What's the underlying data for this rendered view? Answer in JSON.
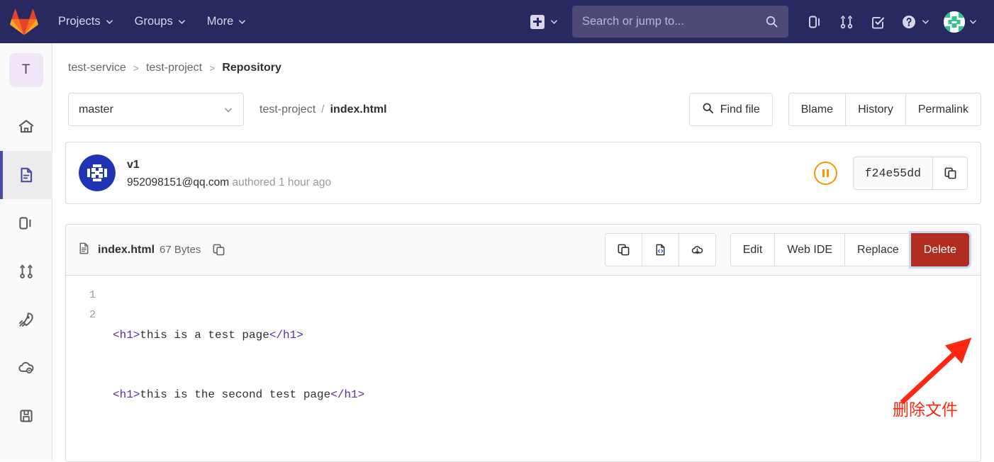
{
  "navbar": {
    "logo_icon": "gitlab-logo-icon",
    "links": [
      {
        "label": "Projects",
        "icon": "chevron-down-icon"
      },
      {
        "label": "Groups",
        "icon": "chevron-down-icon"
      },
      {
        "label": "More",
        "icon": "chevron-down-icon"
      }
    ],
    "create_new": {
      "icon": "plus-square-icon",
      "caret": "chevron-down-icon"
    },
    "search": {
      "placeholder": "Search or jump to...",
      "value": "",
      "icon": "search-icon"
    },
    "icons": [
      {
        "name": "issues-icon"
      },
      {
        "name": "merge-requests-icon"
      },
      {
        "name": "todos-icon"
      },
      {
        "name": "help-icon"
      }
    ],
    "avatar": {
      "name": "user-avatar",
      "color": "#31c48d"
    },
    "background": "#292961"
  },
  "sidebar": {
    "project_avatar": {
      "label": "T",
      "background": "#f0e6f7"
    },
    "items": [
      {
        "name": "sidebar-item-project-overview",
        "icon": "home-icon",
        "active": false
      },
      {
        "name": "sidebar-item-repository",
        "icon": "document-icon",
        "active": true
      },
      {
        "name": "sidebar-item-issues",
        "icon": "issues-icon",
        "active": false
      },
      {
        "name": "sidebar-item-merge-requests",
        "icon": "merge-request-icon",
        "active": false
      },
      {
        "name": "sidebar-item-cicd",
        "icon": "rocket-icon",
        "active": false
      },
      {
        "name": "sidebar-item-operations",
        "icon": "cloud-gear-icon",
        "active": false
      },
      {
        "name": "sidebar-item-packages",
        "icon": "package-icon",
        "active": false
      }
    ],
    "active_color": "#4b4ba3"
  },
  "breadcrumb": {
    "group": "test-service",
    "project": "test-project",
    "section": "Repository",
    "separator": ">"
  },
  "file_bar": {
    "branch": "master",
    "branch_caret": "chevron-down-icon",
    "path_dir": "test-project",
    "path_separator": "/",
    "path_file": "index.html",
    "find_file": {
      "label": "Find file",
      "icon": "search-icon"
    },
    "nav_buttons": [
      "Blame",
      "History",
      "Permalink"
    ]
  },
  "commit": {
    "title": "v1",
    "author": "952098151@qq.com",
    "authored_text": "authored",
    "time_ago": "1 hour ago",
    "avatar_color": "#1f35b5",
    "pipeline_status": {
      "name": "pipeline-pending-icon",
      "color": "#fc9403"
    },
    "sha": "f24e55dd",
    "copy_icon": "copy-icon"
  },
  "file": {
    "icon": "file-document-icon",
    "name": "index.html",
    "size": "67 Bytes",
    "copy_path_icon": "copy-icon",
    "icon_buttons": [
      {
        "name": "copy-contents-button",
        "icon": "copy-icon"
      },
      {
        "name": "open-raw-button",
        "icon": "code-file-icon"
      },
      {
        "name": "download-button",
        "icon": "download-icon"
      }
    ],
    "action_buttons": [
      "Edit",
      "Web IDE",
      "Replace",
      "Delete"
    ],
    "delete_color": "#b02d1f",
    "lines": [
      {
        "number": "1",
        "open_tag": "<h1>",
        "text": "this is a test page",
        "close_tag": "</h1>"
      },
      {
        "number": "2",
        "open_tag": "<h1>",
        "text": "this is the second test page",
        "close_tag": "</h1>"
      }
    ]
  },
  "annotation": {
    "text": "删除文件",
    "color": "#fe2712",
    "arrow_icon": "arrow-up-right-icon"
  }
}
